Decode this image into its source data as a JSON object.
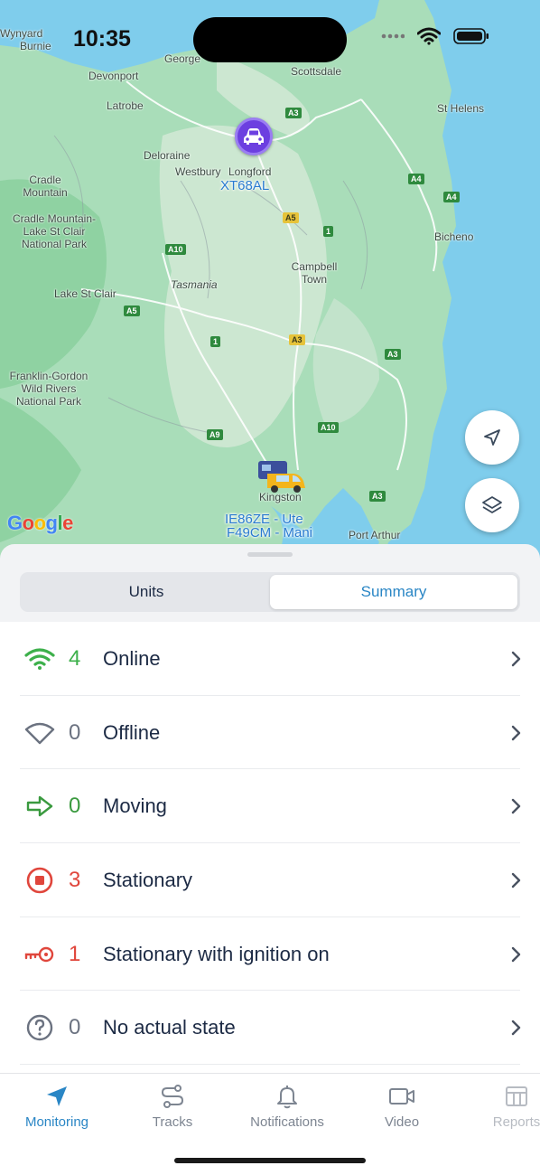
{
  "status_bar": {
    "time": "10:35"
  },
  "map": {
    "places": [
      "Burnie",
      "Devonport",
      "George",
      "Scottsdale",
      "Latrobe",
      "St Helens",
      "Deloraine",
      "Westbury",
      "Longford",
      "Cradle Mountain",
      "Cradle Mountain-Lake St Clair National Park",
      "Bicheno",
      "Tasmania",
      "Campbell Town",
      "Lake St Clair",
      "Franklin-Gordon Wild Rivers National Park",
      "Kingston",
      "Port Arthur",
      "Wynyard"
    ],
    "roads": [
      "A3",
      "A3",
      "A4",
      "A4",
      "1",
      "A5",
      "A10",
      "A5",
      "1",
      "A3",
      "A3",
      "A10",
      "A9"
    ],
    "units": {
      "car": "XT68AL",
      "ute": "IE86ZE - Ute",
      "van": "F49CM - Mani"
    },
    "google_logo": "Google",
    "buttons": {
      "locate": "navigation-arrow-icon",
      "layers": "layers-icon"
    }
  },
  "tabs_segment": {
    "units": "Units",
    "summary": "Summary",
    "active": "Summary"
  },
  "summary_rows": [
    {
      "icon": "wifi-icon",
      "count": "4",
      "label": "Online",
      "color": "#3db04b"
    },
    {
      "icon": "wifi-off-icon",
      "count": "0",
      "label": "Offline",
      "color": "#6b7280"
    },
    {
      "icon": "arrow-right-icon",
      "count": "0",
      "label": "Moving",
      "color": "#3a9a3f"
    },
    {
      "icon": "stop-icon",
      "count": "3",
      "label": "Stationary",
      "color": "#e0463c"
    },
    {
      "icon": "key-icon",
      "count": "1",
      "label": "Stationary with ignition on",
      "color": "#e0463c"
    },
    {
      "icon": "question-icon",
      "count": "0",
      "label": "No actual state",
      "color": "#6b7280"
    }
  ],
  "tabbar": {
    "items": [
      {
        "label": "Monitoring",
        "icon": "location-arrow-icon",
        "active": true
      },
      {
        "label": "Tracks",
        "icon": "route-icon",
        "active": false
      },
      {
        "label": "Notifications",
        "icon": "bell-icon",
        "active": false
      },
      {
        "label": "Video",
        "icon": "video-camera-icon",
        "active": false
      },
      {
        "label": "Reports",
        "icon": "report-table-icon",
        "active": false
      }
    ]
  },
  "colors": {
    "accent": "#2a86c5",
    "online": "#3db04b",
    "stationary": "#e0463c",
    "text": "#1c2a44"
  }
}
